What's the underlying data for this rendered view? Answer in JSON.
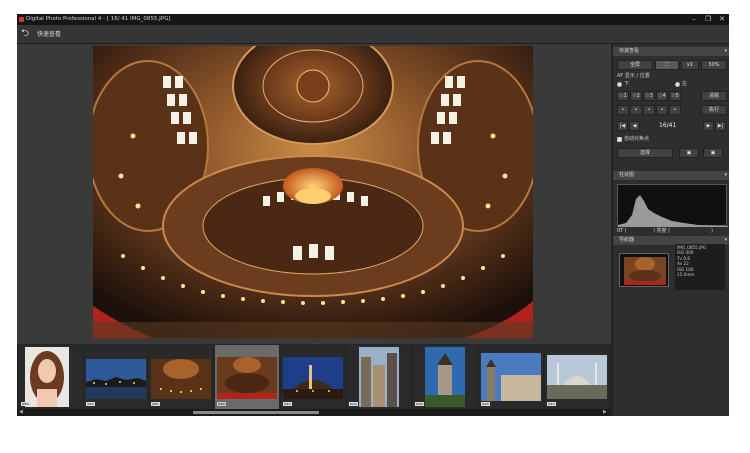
{
  "window": {
    "title": "Digital Photo Professional 4 - [ 16/ 41 IMG_0855.JPG]",
    "controls": {
      "minimize": "–",
      "restore": "❐",
      "close": "✕"
    }
  },
  "toolbar": {
    "back_icon": "back-arrow-icon",
    "view_label": "快速查看"
  },
  "panel": {
    "quick_check": {
      "header": "快速查看",
      "fullscreen_label": "全屏",
      "fit_label": "⛶",
      "zoom_1x_label": "x1",
      "zoom_value": "50%",
      "af_point_label": "AF点显示",
      "display_label": "AF 显示 / 位置",
      "radio_left": "下",
      "radio_right": "左",
      "rating_stars": [
        "☆1",
        "☆2",
        "☆3",
        "☆4",
        "☆5"
      ],
      "clear_label": "清除",
      "dots": [
        "•",
        "•",
        "•",
        "•",
        "•"
      ],
      "apply_label": "执行",
      "nav_first": "|◀",
      "nav_prev": "◀",
      "counter": "16/41",
      "nav_next": "▶",
      "nav_last": "▶|",
      "auto_select_label": "自动对焦点",
      "compare_label": "选择",
      "icon_btn_1": "image-icon",
      "icon_btn_2": "image-icon"
    },
    "histogram": {
      "header": "柱状图",
      "label_left": "RT (",
      "label_mid": ") 亮度 (",
      "label_right": ")"
    },
    "navigator": {
      "header": "导航器",
      "info_lines": [
        "IMG_0855.JPG",
        "ISO 400",
        "Tv 0.6",
        "Av 22",
        "ISO 100",
        "15.0mm"
      ]
    }
  },
  "filmstrip": {
    "grip": "⋯",
    "scroll_left": "◀",
    "scroll_right": "▶",
    "items": [
      {
        "tag": "JPEG",
        "selected": false
      },
      {
        "tag": "JPEG",
        "selected": false
      },
      {
        "tag": "JPEG",
        "selected": false
      },
      {
        "tag": "JPEG",
        "selected": true
      },
      {
        "tag": "JPEG",
        "selected": false
      },
      {
        "tag": "RAW",
        "selected": false
      },
      {
        "tag": "RAW",
        "selected": false
      },
      {
        "tag": "RAW",
        "selected": false
      },
      {
        "tag": "JPEG",
        "selected": false
      }
    ]
  },
  "colors": {
    "background": "#2b2b2b",
    "titlebar": "#161616",
    "panel": "#2e2e2e",
    "dome_red": "#8a2a1e",
    "gold_light": "#f5c66a"
  }
}
